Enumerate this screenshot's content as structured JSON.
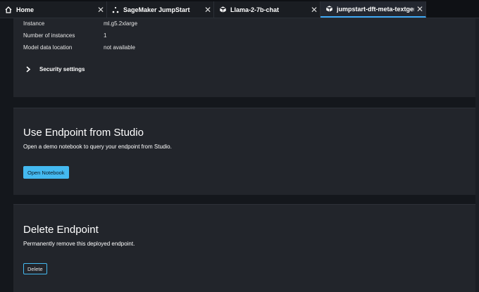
{
  "tabs": [
    {
      "label": "Home",
      "icon": "home-icon"
    },
    {
      "label": "SageMaker JumpStart",
      "icon": "jumpstart-icon"
    },
    {
      "label": "Llama-2-7b-chat",
      "icon": "model-icon"
    },
    {
      "label": "jumpstart-dft-meta-textgener",
      "icon": "model-icon",
      "active": true
    }
  ],
  "details": {
    "rows": [
      {
        "key": "Instance",
        "value": "ml.g5.2xlarge"
      },
      {
        "key": "Number of instances",
        "value": "1"
      },
      {
        "key": "Model data location",
        "value": "not available"
      }
    ],
    "security_label": "Security settings"
  },
  "studio": {
    "title": "Use Endpoint from Studio",
    "description": "Open a demo notebook to query your endpoint from Studio.",
    "button_label": "Open Notebook"
  },
  "delete": {
    "title": "Delete Endpoint",
    "description": "Permanently remove this deployed endpoint.",
    "button_label": "Delete"
  },
  "colors": {
    "accent": "#44b9f0",
    "panel": "#22252b",
    "background": "#14171c"
  }
}
